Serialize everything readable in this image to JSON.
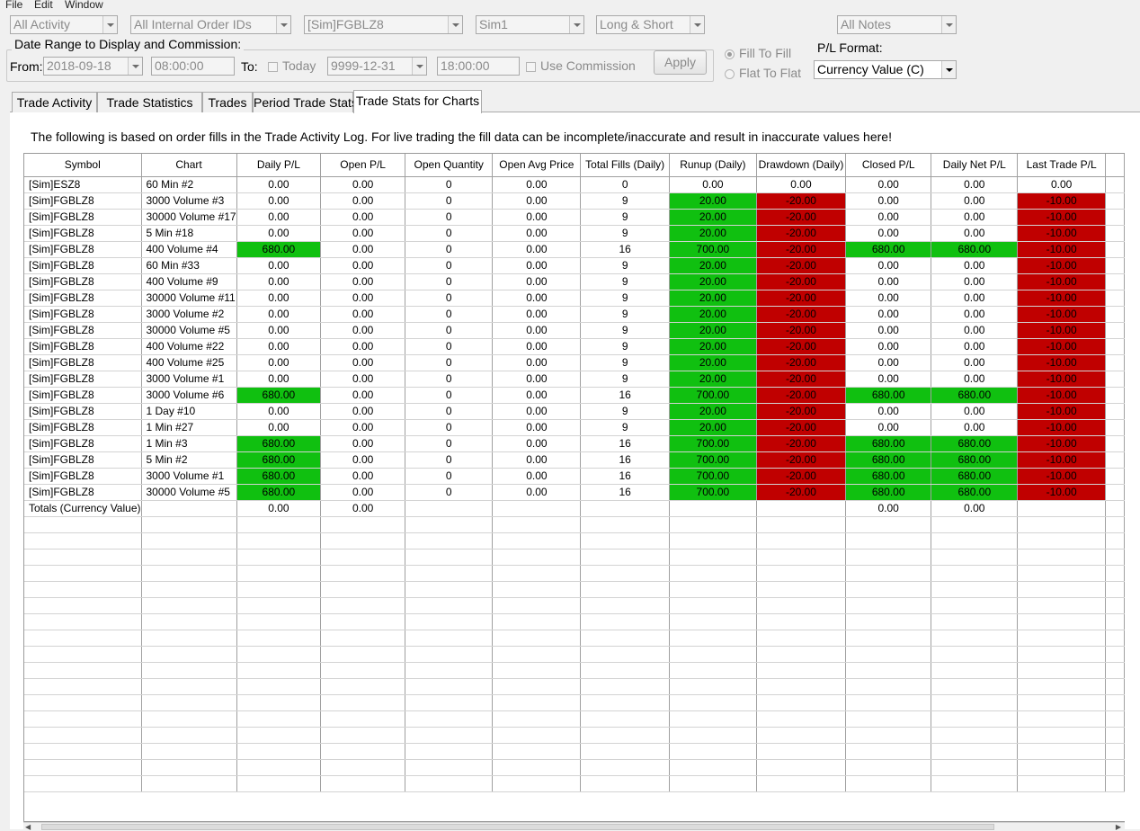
{
  "menu": [
    "File",
    "Edit",
    "Window"
  ],
  "filters": {
    "activity": "All Activity",
    "order_ids": "All Internal Order IDs",
    "symbol": "[Sim]FGBLZ8",
    "account": "Sim1",
    "side": "Long & Short",
    "notes": "All Notes"
  },
  "date_range": {
    "legend": "Date Range to Display and Commission:",
    "from_label": "From:",
    "from_date": "2018-09-18",
    "from_time": "08:00:00",
    "to_label": "To:",
    "today_label": "Today",
    "to_date": "9999-12-31",
    "to_time": "18:00:00",
    "use_commission_label": "Use Commission",
    "apply_label": "Apply"
  },
  "fill_mode": {
    "fill_to_fill": "Fill To Fill",
    "flat_to_flat": "Flat To Flat"
  },
  "pl_format": {
    "label": "P/L Format:",
    "value": "Currency Value (C)"
  },
  "tabs": [
    "Trade Activity",
    "Trade Statistics",
    "Trades",
    "Period Trade Stats",
    "Trade Stats for Charts"
  ],
  "notice": "The following is based on order fills in the Trade Activity Log. For live trading the fill data can be incomplete/inaccurate and result in inaccurate values here!",
  "colors": {
    "positive": "#10c010",
    "negative": "#c00000"
  },
  "table": {
    "columns": [
      "Symbol",
      "Chart",
      "Daily P/L",
      "Open P/L",
      "Open Quantity",
      "Open Avg Price",
      "Total Fills (Daily)",
      "Runup (Daily)",
      "Drawdown (Daily)",
      "Closed P/L",
      "Daily Net P/L",
      "Last Trade P/L"
    ],
    "rows": [
      [
        "[Sim]ESZ8",
        "60 Min  #2",
        "0.00",
        "0.00",
        "0",
        "0.00",
        "0",
        "0.00",
        "0.00",
        "0.00",
        "0.00",
        "0.00"
      ],
      [
        "[Sim]FGBLZ8",
        "3000 Volume  #3",
        "0.00",
        "0.00",
        "0",
        "0.00",
        "9",
        "20.00",
        "-20.00",
        "0.00",
        "0.00",
        "-10.00"
      ],
      [
        "[Sim]FGBLZ8",
        "30000 Volume  #17",
        "0.00",
        "0.00",
        "0",
        "0.00",
        "9",
        "20.00",
        "-20.00",
        "0.00",
        "0.00",
        "-10.00"
      ],
      [
        "[Sim]FGBLZ8",
        "5 Min  #18",
        "0.00",
        "0.00",
        "0",
        "0.00",
        "9",
        "20.00",
        "-20.00",
        "0.00",
        "0.00",
        "-10.00"
      ],
      [
        "[Sim]FGBLZ8",
        "400 Volume  #4",
        "680.00",
        "0.00",
        "0",
        "0.00",
        "16",
        "700.00",
        "-20.00",
        "680.00",
        "680.00",
        "-10.00"
      ],
      [
        "[Sim]FGBLZ8",
        "60 Min  #33",
        "0.00",
        "0.00",
        "0",
        "0.00",
        "9",
        "20.00",
        "-20.00",
        "0.00",
        "0.00",
        "-10.00"
      ],
      [
        "[Sim]FGBLZ8",
        "400 Volume  #9",
        "0.00",
        "0.00",
        "0",
        "0.00",
        "9",
        "20.00",
        "-20.00",
        "0.00",
        "0.00",
        "-10.00"
      ],
      [
        "[Sim]FGBLZ8",
        "30000 Volume  #11",
        "0.00",
        "0.00",
        "0",
        "0.00",
        "9",
        "20.00",
        "-20.00",
        "0.00",
        "0.00",
        "-10.00"
      ],
      [
        "[Sim]FGBLZ8",
        "3000 Volume  #2",
        "0.00",
        "0.00",
        "0",
        "0.00",
        "9",
        "20.00",
        "-20.00",
        "0.00",
        "0.00",
        "-10.00"
      ],
      [
        "[Sim]FGBLZ8",
        "30000 Volume  #5",
        "0.00",
        "0.00",
        "0",
        "0.00",
        "9",
        "20.00",
        "-20.00",
        "0.00",
        "0.00",
        "-10.00"
      ],
      [
        "[Sim]FGBLZ8",
        "400 Volume  #22",
        "0.00",
        "0.00",
        "0",
        "0.00",
        "9",
        "20.00",
        "-20.00",
        "0.00",
        "0.00",
        "-10.00"
      ],
      [
        "[Sim]FGBLZ8",
        "400 Volume  #25",
        "0.00",
        "0.00",
        "0",
        "0.00",
        "9",
        "20.00",
        "-20.00",
        "0.00",
        "0.00",
        "-10.00"
      ],
      [
        "[Sim]FGBLZ8",
        "3000 Volume  #1",
        "0.00",
        "0.00",
        "0",
        "0.00",
        "9",
        "20.00",
        "-20.00",
        "0.00",
        "0.00",
        "-10.00"
      ],
      [
        "[Sim]FGBLZ8",
        "3000 Volume  #6",
        "680.00",
        "0.00",
        "0",
        "0.00",
        "16",
        "700.00",
        "-20.00",
        "680.00",
        "680.00",
        "-10.00"
      ],
      [
        "[Sim]FGBLZ8",
        "1 Day  #10",
        "0.00",
        "0.00",
        "0",
        "0.00",
        "9",
        "20.00",
        "-20.00",
        "0.00",
        "0.00",
        "-10.00"
      ],
      [
        "[Sim]FGBLZ8",
        "1 Min  #27",
        "0.00",
        "0.00",
        "0",
        "0.00",
        "9",
        "20.00",
        "-20.00",
        "0.00",
        "0.00",
        "-10.00"
      ],
      [
        "[Sim]FGBLZ8",
        "1 Min  #3",
        "680.00",
        "0.00",
        "0",
        "0.00",
        "16",
        "700.00",
        "-20.00",
        "680.00",
        "680.00",
        "-10.00"
      ],
      [
        "[Sim]FGBLZ8",
        "5 Min  #2",
        "680.00",
        "0.00",
        "0",
        "0.00",
        "16",
        "700.00",
        "-20.00",
        "680.00",
        "680.00",
        "-10.00"
      ],
      [
        "[Sim]FGBLZ8",
        "3000 Volume  #1",
        "680.00",
        "0.00",
        "0",
        "0.00",
        "16",
        "700.00",
        "-20.00",
        "680.00",
        "680.00",
        "-10.00"
      ],
      [
        "[Sim]FGBLZ8",
        "30000 Volume  #5",
        "680.00",
        "0.00",
        "0",
        "0.00",
        "16",
        "700.00",
        "-20.00",
        "680.00",
        "680.00",
        "-10.00"
      ]
    ],
    "totals": [
      "Totals (Currency Value)",
      "",
      "0.00",
      "0.00",
      "",
      "",
      "",
      "",
      "",
      "0.00",
      "0.00",
      ""
    ],
    "empty_rows": 17
  }
}
